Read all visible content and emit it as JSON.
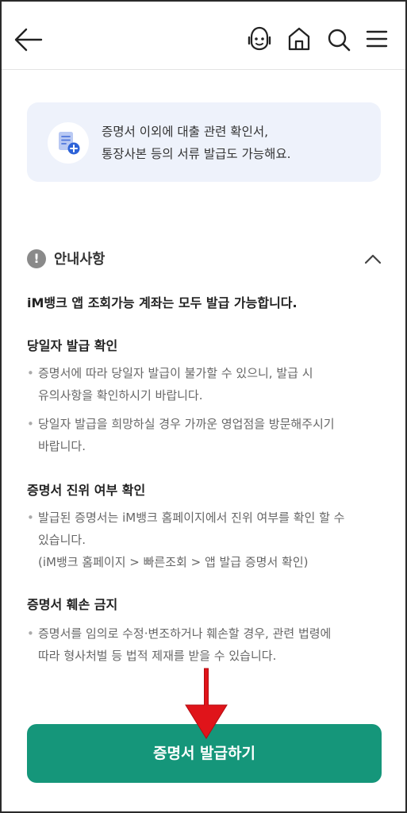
{
  "header": {
    "icons": [
      "arrow-left-icon",
      "chatbot-icon",
      "home-icon",
      "search-icon",
      "menu-icon"
    ]
  },
  "info_card": {
    "icon": "document-plus-icon",
    "line1": "증명서 이외에 대출 관련 확인서,",
    "line2": "통장사본 등의 서류 발급도 가능해요."
  },
  "notice": {
    "title": "안내사항",
    "icon": "exclamation-circle-icon",
    "headline": "iM뱅크 앱 조회가능 계좌는 모두 발급 가능합니다.",
    "sections": [
      {
        "title": "당일자 발급 확인",
        "bullets": [
          {
            "lines": [
              "증명서에 따라 당일자 발급이 불가할 수 있으니, 발급 시",
              "유의사항을 확인하시기 바랍니다."
            ]
          },
          {
            "lines": [
              "당일자 발급을 희망하실 경우 가까운 영업점을 방문해주시기",
              "바랍니다."
            ]
          }
        ]
      },
      {
        "title": "증명서 진위 여부 확인",
        "bullets": [
          {
            "lines": [
              "발급된 증명서는 iM뱅크 홈페이지에서 진위 여부를 확인 할 수",
              "있습니다.",
              "(iM뱅크 홈페이지 > 빠른조회 > 앱 발급 증명서 확인)"
            ]
          }
        ]
      },
      {
        "title": "증명서 훼손 금지",
        "bullets": [
          {
            "lines": [
              "증명서를 임의로 수정·변조하거나 훼손할 경우, 관련 법령에",
              "따라 형사처벌 등 법적 제재를 받을 수 있습니다."
            ]
          }
        ]
      }
    ]
  },
  "cta": {
    "label": "증명서 발급하기"
  },
  "colors": {
    "primary": "#15967a",
    "info_bg": "#eef2fb",
    "accent_blue": "#2d63d8",
    "arrow_red": "#e0141a"
  }
}
